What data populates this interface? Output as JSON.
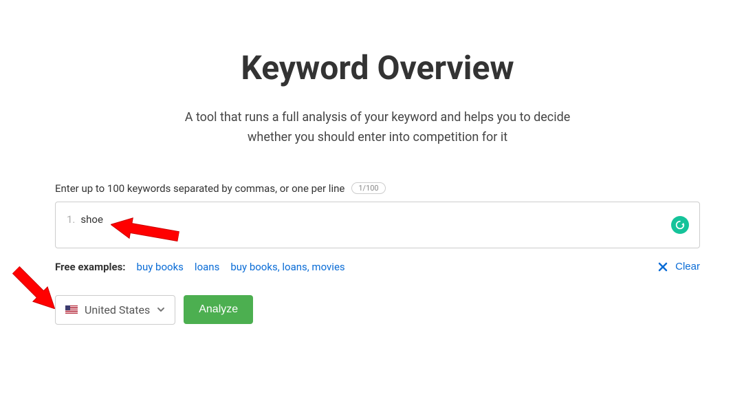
{
  "header": {
    "title": "Keyword Overview",
    "description": "A tool that runs a full analysis of your keyword and helps you to decide whether you should enter into competition for it"
  },
  "input": {
    "label": "Enter up to 100 keywords separated by commas, or one per line",
    "count": "1/100",
    "line_number": "1.",
    "value": "shoe"
  },
  "examples": {
    "label": "Free examples:",
    "items": [
      "buy books",
      "loans",
      "buy books, loans, movies"
    ]
  },
  "clear": {
    "label": "Clear"
  },
  "country": {
    "selected": "United States"
  },
  "analyze": {
    "label": "Analyze"
  }
}
